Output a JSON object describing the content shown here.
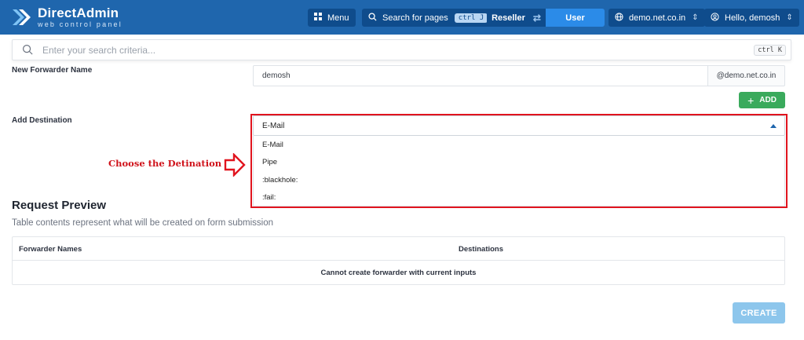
{
  "brand": {
    "title": "DirectAdmin",
    "subtitle": "web control panel"
  },
  "topbar": {
    "menu_label": "Menu",
    "search_pages_label": "Search for pages",
    "search_pages_shortcut": "ctrl J",
    "role_left": "Reseller",
    "role_right": "User",
    "domain": "demo.net.co.in",
    "greeting": "Hello, demosh"
  },
  "search": {
    "placeholder": "Enter your search criteria...",
    "shortcut": "ctrl K"
  },
  "form": {
    "forwarder_label": "New Forwarder Name",
    "forwarder_value": "demosh",
    "domain_suffix": "@demo.net.co.in",
    "add_button": "ADD",
    "destination_label": "Add Destination",
    "destination_selected": "E-Mail",
    "destination_options": [
      "E-Mail",
      "Pipe",
      ":blackhole:",
      ":fail:"
    ]
  },
  "annotation": {
    "text": "Choose the Detination"
  },
  "preview": {
    "title": "Request Preview",
    "subtitle": "Table contents represent what will be created on form submission",
    "columns": [
      "Forwarder Names",
      "Destinations"
    ],
    "empty_message": "Cannot create forwarder with current inputs"
  },
  "actions": {
    "create_button": "CREATE"
  },
  "colors": {
    "topbar": "#1f66ad",
    "accent": "#2b8be8",
    "add_green": "#3aaa5c",
    "annotation_red": "#e1141e",
    "create_disabled": "#8dc6ec"
  }
}
